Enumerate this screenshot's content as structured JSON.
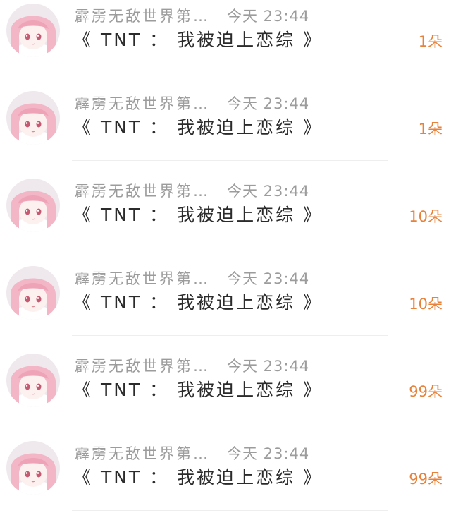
{
  "list": {
    "items": [
      {
        "user": "霹雳无敌世界第…",
        "time": "今天 23:44",
        "title": "《 TNT ： 我被迫上恋综 》",
        "amount": "1朵"
      },
      {
        "user": "霹雳无敌世界第…",
        "time": "今天 23:44",
        "title": "《 TNT ： 我被迫上恋综 》",
        "amount": "1朵"
      },
      {
        "user": "霹雳无敌世界第…",
        "time": "今天 23:44",
        "title": "《 TNT ： 我被迫上恋综 》",
        "amount": "10朵"
      },
      {
        "user": "霹雳无敌世界第…",
        "time": "今天 23:44",
        "title": "《 TNT ： 我被迫上恋综 》",
        "amount": "10朵"
      },
      {
        "user": "霹雳无敌世界第…",
        "time": "今天 23:44",
        "title": "《 TNT ： 我被迫上恋综 》",
        "amount": "99朵"
      },
      {
        "user": "霹雳无敌世界第…",
        "time": "今天 23:44",
        "title": "《 TNT ： 我被迫上恋综 》",
        "amount": "99朵"
      }
    ]
  },
  "colors": {
    "amount": "#e8823a",
    "meta": "#9c9c9c",
    "title": "#2b2b2b",
    "avatar_hair": "#f2b6c6",
    "avatar_eye": "#c45a72"
  },
  "icons": {
    "avatar": "anime-girl-avatar-icon"
  }
}
